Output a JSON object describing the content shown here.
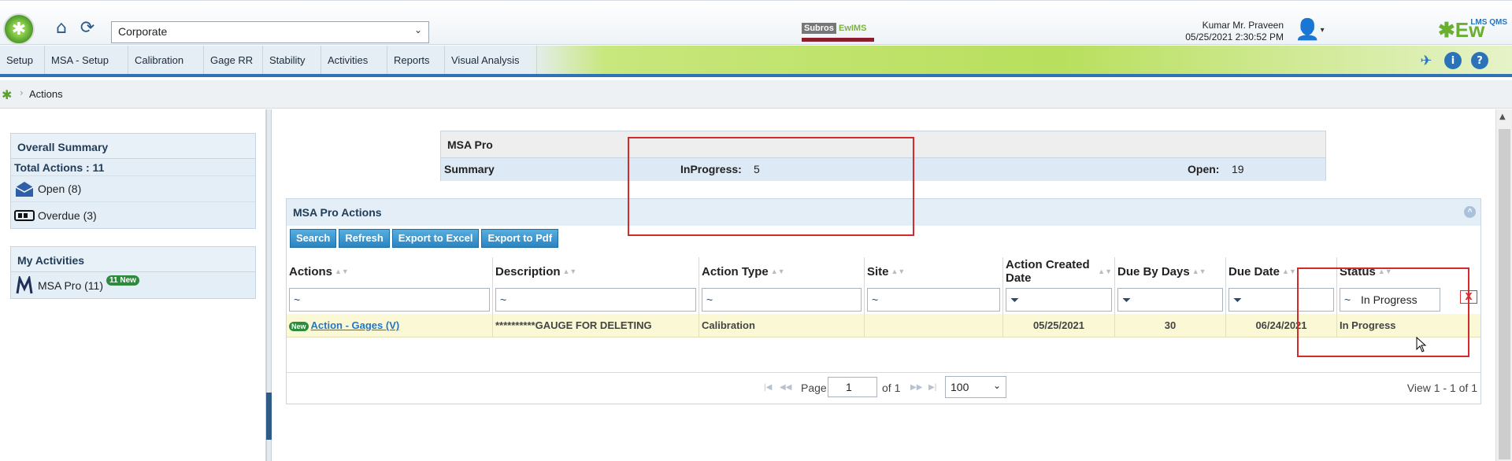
{
  "header": {
    "org_select_value": "Corporate",
    "center_logo_left": "Subros",
    "center_logo_right": "EwIMS",
    "user_name": "Kumar Mr. Praveen",
    "datetime": "05/25/2021 2:30:52 PM",
    "brand": "Ew",
    "brand_small": "LMS QMS"
  },
  "nav": {
    "items": [
      "Setup",
      "MSA - Setup",
      "Calibration",
      "Gage RR",
      "Stability",
      "Activities",
      "Reports",
      "Visual Analysis"
    ],
    "info_icon": "i",
    "help_icon": "?"
  },
  "breadcrumb": {
    "label": "Actions"
  },
  "left": {
    "overall_title": "Overall Summary",
    "total_actions": "Total Actions : 11",
    "open": "Open (8)",
    "overdue": "Overdue (3)",
    "activities_title": "My Activities",
    "msa_pro": "MSA Pro (11)",
    "new_badge": "11 New"
  },
  "summary": {
    "title": "MSA Pro",
    "label": "Summary",
    "inprogress_label": "InProgress:",
    "inprogress_value": "5",
    "open_label": "Open:",
    "open_value": "19"
  },
  "grid": {
    "title": "MSA Pro Actions",
    "buttons": [
      "Search",
      "Refresh",
      "Export to Excel",
      "Export to Pdf"
    ],
    "columns": [
      "Actions",
      "Description",
      "Action Type",
      "Site",
      "Action Created Date",
      "Due By Days",
      "Due Date",
      "Status"
    ],
    "filters": {
      "text_symbol": "~",
      "status_value": "In Progress",
      "clear": "X"
    },
    "rows": [
      {
        "new": "New",
        "action": "Action - Gages (V)",
        "description": "**********GAUGE FOR DELETING",
        "action_type": "Calibration",
        "site": "",
        "created": "05/25/2021",
        "due_by_days": "30",
        "due_date": "06/24/2021",
        "status": "In Progress"
      }
    ],
    "pager": {
      "page_label": "Page",
      "page_value": "1",
      "of_label": "of 1",
      "page_size": "100",
      "view_info": "View 1 - 1 of 1"
    }
  },
  "colors": {
    "accent": "#2f72b5",
    "highlight_row": "#fbf8d6",
    "annotation_red": "#d32b2b",
    "button_blue": "#2a84c0"
  }
}
